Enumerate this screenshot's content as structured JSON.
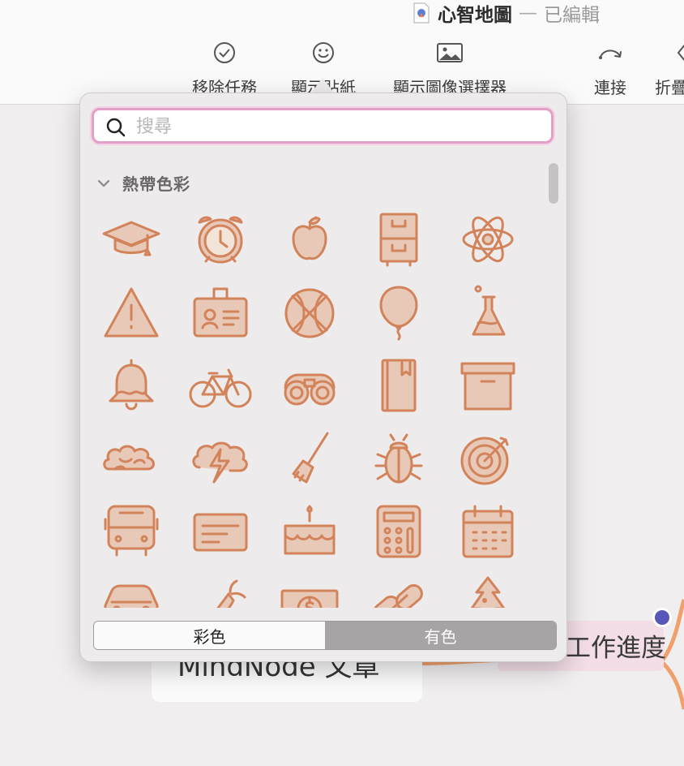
{
  "window": {
    "document_title": "心智地圖",
    "separator": "—",
    "status": "已編輯"
  },
  "toolbar": {
    "items": [
      {
        "label": "移除任務",
        "icon": "check-circle-icon"
      },
      {
        "label": "顯示貼紙",
        "icon": "smiley-icon"
      },
      {
        "label": "顯示圖像選擇器",
        "icon": "image-icon"
      },
      {
        "label": "連接",
        "icon": "connect-arrow-icon"
      },
      {
        "label": "折疊",
        "icon": "chevron-left-icon"
      }
    ]
  },
  "canvas": {
    "nodes": [
      {
        "label": "MindNode 文章"
      },
      {
        "label": "工作進度"
      }
    ]
  },
  "sticker_picker": {
    "search": {
      "placeholder": "搜尋",
      "value": ""
    },
    "section": {
      "title": "熱帶色彩",
      "expanded": true
    },
    "stickers": [
      "graduation-cap-icon",
      "alarm-clock-icon",
      "apple-icon",
      "file-cabinet-icon",
      "atom-icon",
      "warning-icon",
      "id-badge-icon",
      "basketball-icon",
      "balloon-icon",
      "flask-icon",
      "bell-icon",
      "bicycle-icon",
      "binoculars-icon",
      "book-icon",
      "box-icon",
      "brain-icon",
      "brainstorm-icon",
      "broom-icon",
      "bug-icon",
      "target-icon",
      "bus-icon",
      "card-icon",
      "cake-icon",
      "calculator-icon",
      "calendar-icon",
      "car-icon",
      "carrot-icon",
      "cash-icon",
      "chain-link-icon",
      "christmas-tree-icon"
    ],
    "style_toggle": {
      "options": [
        "彩色",
        "有色"
      ],
      "selected": "有色"
    }
  },
  "colors": {
    "sticker_stroke": "#d2835a",
    "sticker_fill": "#e8c9b8",
    "search_focus": "#e1a0c6",
    "branch": "#f0a06a",
    "node_dot": "#5757b8"
  }
}
